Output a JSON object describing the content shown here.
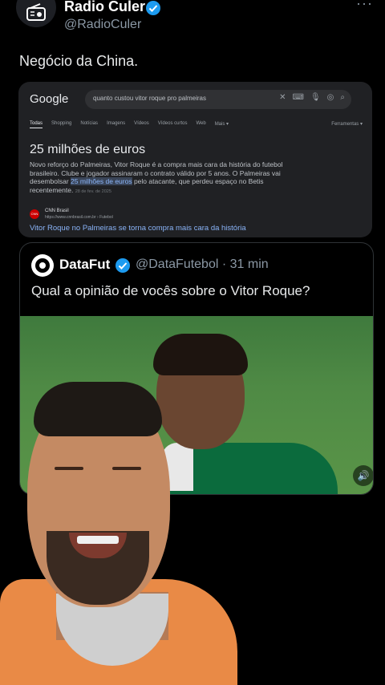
{
  "tweet": {
    "display_name": "Radio Culer",
    "handle": "@RadioCuler",
    "more_label": "···",
    "text": "Negócio da China."
  },
  "google": {
    "logo": "Google",
    "query": "quanto custou vitor roque pro palmeiras",
    "tabs": [
      "Todas",
      "Shopping",
      "Notícias",
      "Imagens",
      "Vídeos",
      "Vídeos curtos",
      "Web",
      "Mais ▾"
    ],
    "tools_label": "Ferramentas ▾",
    "answer": "25 milhões de euros",
    "snippet_before": "Novo reforço do Palmeiras, Vitor Roque é a compra mais cara da história do futebol brasileiro. Clube e jogador assinaram o contrato válido por 5 anos. O Palmeiras vai desembolsar ",
    "snippet_highlight": "25 milhões de euros",
    "snippet_after": " pelo atacante, que perdeu espaço no Betis recentemente.",
    "snippet_date": "28 de fev. de 2025",
    "source_icon": "CNN",
    "source_name": "CNN Brasil",
    "source_url": "https://www.cnnbrasil.com.br › Futebol",
    "link_text": "Vitor Roque no Palmeiras se torna compra mais cara da história"
  },
  "quote": {
    "display_name": "DataFut",
    "handle": "@DataFutebol · 31 min",
    "text": "Qual a opinião de vocês sobre o Vitor Roque?"
  },
  "icons": {
    "avatar": "radio-icon",
    "verified": "verified-badge-icon",
    "volume": "speaker-icon"
  },
  "colors": {
    "background": "#000000",
    "verified_blue": "#1d9bf0",
    "link_blue": "#8ab4f8",
    "secondary_text": "#8b98a5"
  }
}
